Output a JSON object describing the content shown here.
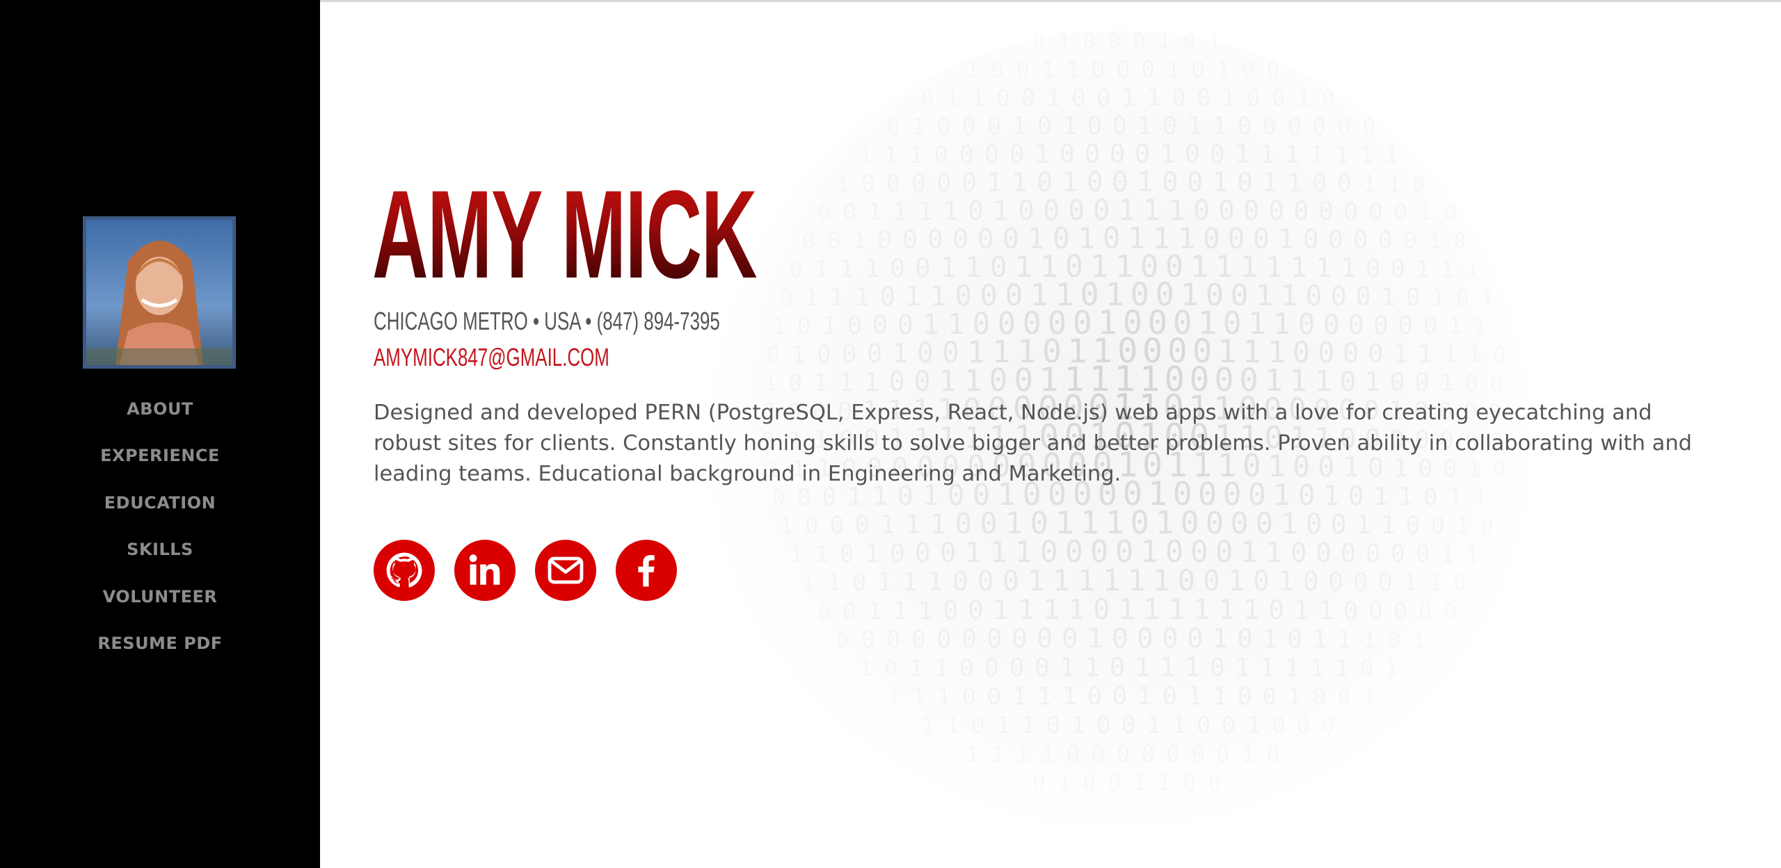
{
  "sidebar": {
    "avatar_alt": "Amy Mick profile photo",
    "nav": [
      {
        "label": "ABOUT"
      },
      {
        "label": "EXPERIENCE"
      },
      {
        "label": "EDUCATION"
      },
      {
        "label": "SKILLS"
      },
      {
        "label": "VOLUNTEER"
      },
      {
        "label": "RESUME PDF"
      }
    ]
  },
  "hero": {
    "name": "AMY MICK",
    "contact_line": "CHICAGO METRO • USA • (847) 894-7395",
    "email": "AMYMICK847@GMAIL.COM",
    "bio": "Designed and developed PERN (PostgreSQL, Express, React, Node.js) web apps with a love for creating eyecatching and robust sites for clients. Constantly honing skills to solve bigger and better problems. Proven ability in collaborating with and leading teams. Educational background in Engineering and Marketing."
  },
  "socials": [
    {
      "icon": "github-icon"
    },
    {
      "icon": "linkedin-icon"
    },
    {
      "icon": "email-icon"
    },
    {
      "icon": "facebook-icon"
    }
  ],
  "colors": {
    "sidebar_bg": "#000000",
    "nav_text": "#8c8c8c",
    "accent_red": "#d90000",
    "name_red_top": "#c3100f",
    "name_red_bottom": "#3a0202",
    "body_text": "#555555",
    "avatar_border": "#3c5a85"
  }
}
